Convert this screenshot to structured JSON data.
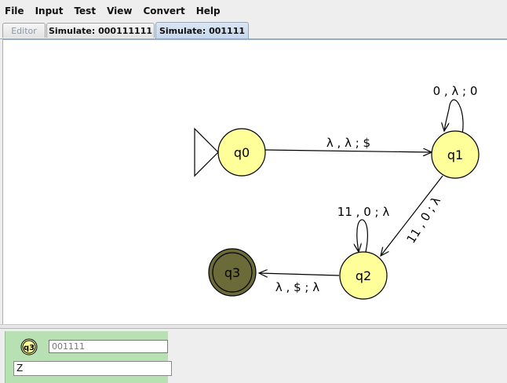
{
  "menu": {
    "items": [
      "File",
      "Input",
      "Test",
      "View",
      "Convert",
      "Help"
    ]
  },
  "tabs": [
    {
      "label": "Editor",
      "state": "disabled"
    },
    {
      "label": "Simulate: 000111111",
      "state": "inactive"
    },
    {
      "label": "Simulate: 001111",
      "state": "active"
    }
  ],
  "automaton": {
    "states": [
      {
        "id": "q0",
        "label": "q0",
        "initial": true,
        "final": false,
        "highlighted": false
      },
      {
        "id": "q1",
        "label": "q1",
        "initial": false,
        "final": false,
        "highlighted": false
      },
      {
        "id": "q2",
        "label": "q2",
        "initial": false,
        "final": false,
        "highlighted": false
      },
      {
        "id": "q3",
        "label": "q3",
        "initial": false,
        "final": true,
        "highlighted": true
      }
    ],
    "transitions": [
      {
        "from": "q0",
        "to": "q1",
        "label": "λ , λ ; $"
      },
      {
        "from": "q1",
        "to": "q1",
        "label": "0 , λ ; 0"
      },
      {
        "from": "q1",
        "to": "q2",
        "label": "11 , 0 ; λ"
      },
      {
        "from": "q2",
        "to": "q2",
        "label": "11 , 0 ; λ"
      },
      {
        "from": "q2",
        "to": "q3",
        "label": "λ , $ ; λ"
      }
    ]
  },
  "configuration": {
    "state_label": "q3",
    "input_remaining": "001111",
    "stack": "Z"
  },
  "colors": {
    "state_fill": "#ffff99",
    "state_highlight_fill": "#6b6b3a",
    "config_background": "#b7e1b2"
  }
}
